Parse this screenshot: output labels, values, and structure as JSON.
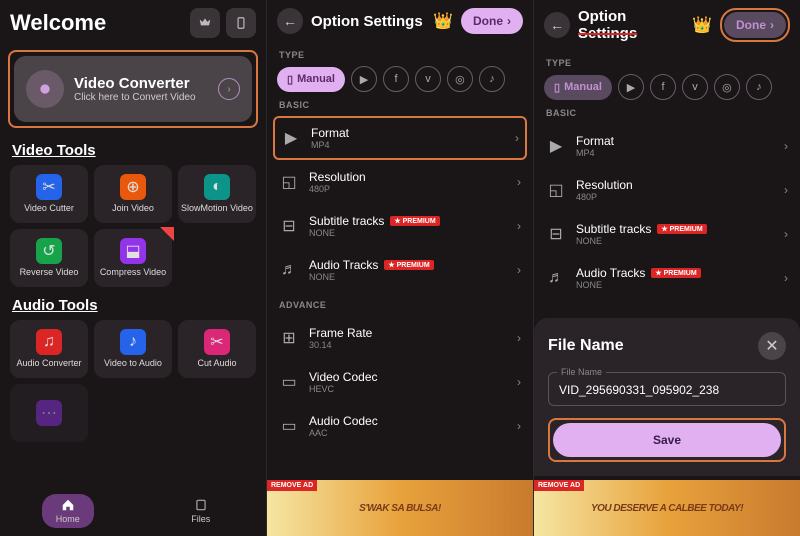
{
  "panel1": {
    "welcome": "Welcome",
    "vc": {
      "title": "Video Converter",
      "sub": "Click here to Convert Video"
    },
    "video_tools_h": "Video Tools",
    "video_tools": [
      "Video Cutter",
      "Join Video",
      "SlowMotion Video",
      "Reverse Video",
      "Compress Video"
    ],
    "audio_tools_h": "Audio Tools",
    "audio_tools": [
      "Audio Converter",
      "Video to Audio",
      "Cut Audio"
    ],
    "nav": {
      "home": "Home",
      "files": "Files"
    }
  },
  "panel2": {
    "title": "Option Settings",
    "done": "Done",
    "type_label": "TYPE",
    "manual": "Manual",
    "basic_label": "BASIC",
    "format": {
      "label": "Format",
      "val": "MP4"
    },
    "resolution": {
      "label": "Resolution",
      "val": "480P"
    },
    "subtitle": {
      "label": "Subtitle tracks",
      "val": "NONE",
      "premium": "★ PREMIUM"
    },
    "audio": {
      "label": "Audio Tracks",
      "val": "NONE",
      "premium": "★ PREMIUM"
    },
    "advance_label": "ADVANCE",
    "framerate": {
      "label": "Frame Rate",
      "val": "30.14"
    },
    "vcodec": {
      "label": "Video Codec",
      "val": "HEVC"
    },
    "acodec": {
      "label": "Audio Codec",
      "val": "AAC"
    },
    "remove_ad": "REMOVE AD",
    "ad_text": "S'WAK SA BULSA!"
  },
  "panel3": {
    "title_a": "Option ",
    "title_b": "Settings",
    "done": "Done",
    "type_label": "TYPE",
    "manual": "Manual",
    "basic_label": "BASIC",
    "format": {
      "label": "Format",
      "val": "MP4"
    },
    "resolution": {
      "label": "Resolution",
      "val": "480P"
    },
    "subtitle": {
      "label": "Subtitle tracks",
      "val": "NONE",
      "premium": "★ PREMIUM"
    },
    "audio": {
      "label": "Audio Tracks",
      "val": "NONE",
      "premium": "★ PREMIUM"
    },
    "modal": {
      "title": "File Name",
      "input_label": "File Name",
      "input_val": "VID_295690331_095902_238",
      "save": "Save"
    },
    "remove_ad": "REMOVE AD",
    "ad_text": "YOU DESERVE A CALBEE TODAY!"
  }
}
